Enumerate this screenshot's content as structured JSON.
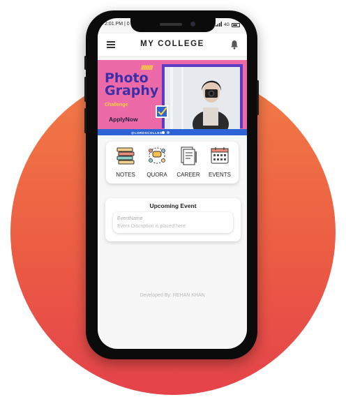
{
  "status_bar": {
    "time": "2:01 PM | 0",
    "wifi_label": "4G"
  },
  "app_bar": {
    "title": "MY COLLEGE"
  },
  "banner": {
    "line1": "Photo",
    "line2": "Graphy",
    "subtitle": "Challenge",
    "cta": "ApplyNow",
    "handle": "@LORDSCOLLEGE",
    "stripes": "///////////"
  },
  "quick_links": [
    {
      "label": "NOTES",
      "icon": "books-icon"
    },
    {
      "label": "QUORA",
      "icon": "discussion-icon"
    },
    {
      "label": "CAREER",
      "icon": "resume-icon"
    },
    {
      "label": "EVENTS",
      "icon": "calendar-icon"
    }
  ],
  "upcoming": {
    "title": "Upcoming Event",
    "event_name": "EventName",
    "event_description": "Event Discription is placed here"
  },
  "footer": {
    "credit": "Developed By: REHAN KHAN"
  },
  "colors": {
    "accent": "#ec5d44",
    "banner_pink": "#ed6aa8",
    "banner_blue": "#2e63d6",
    "banner_purple": "#5b3cc4"
  }
}
